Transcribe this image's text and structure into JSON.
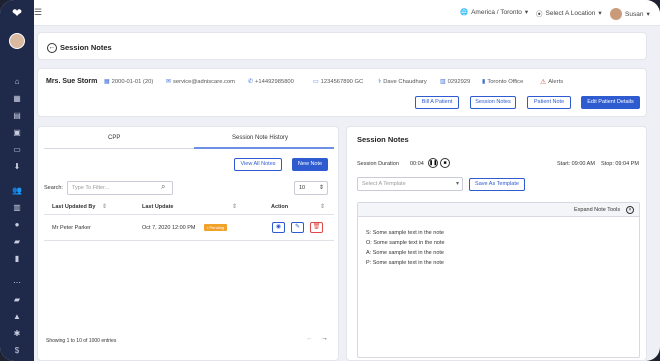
{
  "topbar": {
    "region": "America / Toronto",
    "location": "Select A Location",
    "user": "Susan"
  },
  "header": {
    "title": "Session Notes"
  },
  "patient": {
    "name": "Mrs. Sue Storm",
    "dob": "2000-01-01 (20)",
    "email": "service@adniscare.com",
    "phone": "+14492985800",
    "health_card": "1234567890 GC",
    "doctor": "Dave Chaudhary",
    "chart_no": "0292929",
    "office": "Toronto Office",
    "alerts": "Alerts"
  },
  "patient_actions": {
    "bill": "Bill A Patient",
    "session_notes": "Session Notes",
    "patient_note": "Patient Note",
    "edit_details": "Edit Patient Details"
  },
  "left_panel": {
    "tab_cpp": "CPP",
    "tab_history": "Session Note History",
    "view_all": "View All Notes",
    "new_note": "New Note",
    "search_label": "Search:",
    "search_placeholder": "Type To Filter...",
    "page_size": "10",
    "columns": [
      "Last Updated By",
      "Last Update",
      "Action"
    ],
    "rows": [
      {
        "updated_by": "Mr Peter Parker",
        "last_update": "Oct 7, 2020 12:00 PM",
        "status": "• Pending"
      }
    ],
    "footer": "Showing 1 to 10 of 1000 entries"
  },
  "right_panel": {
    "title": "Session Notes",
    "duration_label": "Session Duration",
    "duration_value": "00:04",
    "start": "Start: 09:00 AM",
    "stop": "Stop: 09:04 PM",
    "template_placeholder": "Select A Template",
    "save_template": "Save As Template",
    "expand_tools": "Expand Note Tools",
    "note_lines": [
      "S: Some sample text in the note",
      "O: Some sample text in the note",
      "A: Some sample text in the note",
      "P: Some sample text in the note"
    ]
  },
  "colors": {
    "sidebar": "#1f2a4a",
    "accent": "#2e5bd0",
    "pending": "#f2a12a",
    "delete": "#e04848"
  }
}
